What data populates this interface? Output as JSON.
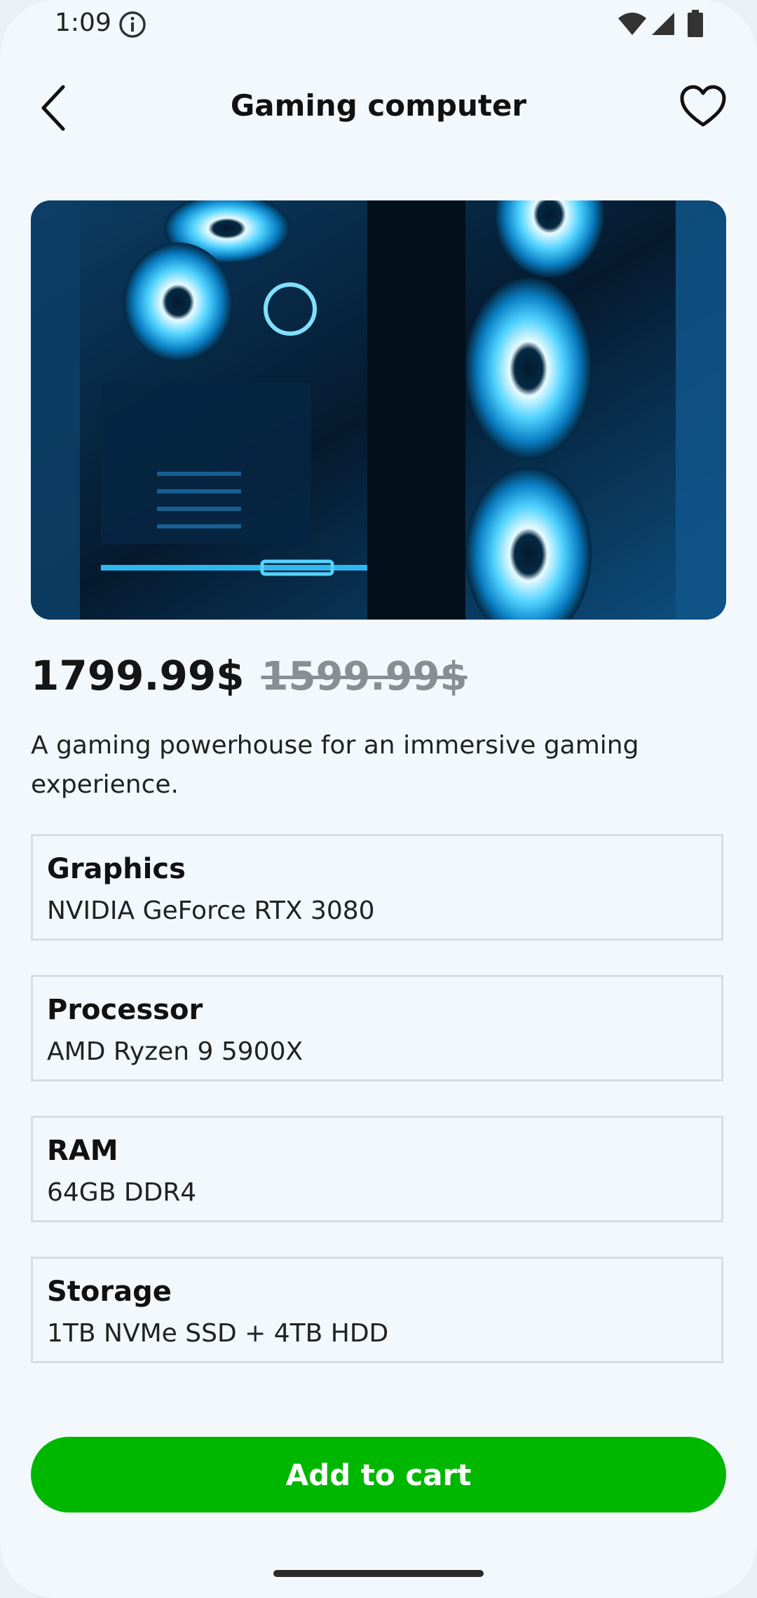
{
  "status_bar": {
    "time": "1:09",
    "icons": [
      "info-icon",
      "wifi-icon",
      "signal-icon",
      "battery-icon"
    ]
  },
  "header": {
    "title": "Gaming computer",
    "back_icon": "chevron-left-icon",
    "favorite_icon": "heart-icon"
  },
  "product": {
    "image": "gaming-pc-image",
    "price": "1799.99$",
    "old_price": "1599.99$",
    "description": "A gaming powerhouse for an immersive gaming experience.",
    "specs": [
      {
        "label": "Graphics",
        "value": "NVIDIA GeForce RTX 3080"
      },
      {
        "label": "Processor",
        "value": "AMD Ryzen 9 5900X"
      },
      {
        "label": "RAM",
        "value": "64GB DDR4"
      },
      {
        "label": "Storage",
        "value": "1TB NVMe SSD + 4TB HDD"
      }
    ]
  },
  "actions": {
    "add_to_cart_label": "Add to cart"
  },
  "colors": {
    "background": "#f2f8fc",
    "accent": "#00b700",
    "old_price": "#8a8e92"
  }
}
